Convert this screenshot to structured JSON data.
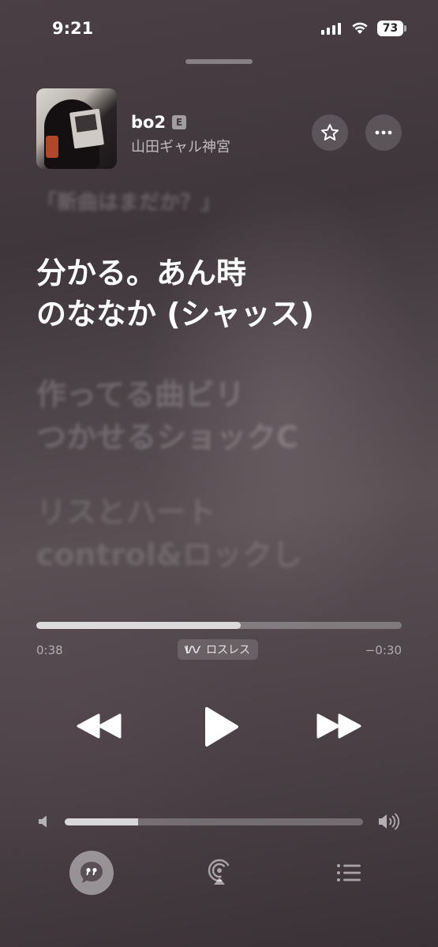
{
  "status_bar": {
    "time": "9:21",
    "battery_level": "73"
  },
  "now_playing": {
    "title": "bo2",
    "explicit_badge": "E",
    "artist": "山田ギャル神宮"
  },
  "lyrics": {
    "previous": "「新曲はまだか？」",
    "current_line1": "分かる。あん時",
    "current_line2": "のななか (シャッス)",
    "next_line1": "作ってる曲ビリ",
    "next_line2": "つかせるショックC",
    "next_line3": "リスとハート",
    "next_line4": "control&ロックし"
  },
  "playback": {
    "elapsed": "0:38",
    "remaining": "−0:30",
    "progress_fraction": 0.56,
    "lossless_label": "ロスレス"
  },
  "volume": {
    "level_fraction": 0.245
  },
  "icons": {
    "star": "star-icon",
    "more": "ellipsis-icon",
    "rewind": "backward-icon",
    "play": "play-icon",
    "forward": "forward-icon",
    "lyrics": "quote-bubble-icon",
    "airplay": "airplay-audio-icon",
    "queue": "list-icon"
  }
}
